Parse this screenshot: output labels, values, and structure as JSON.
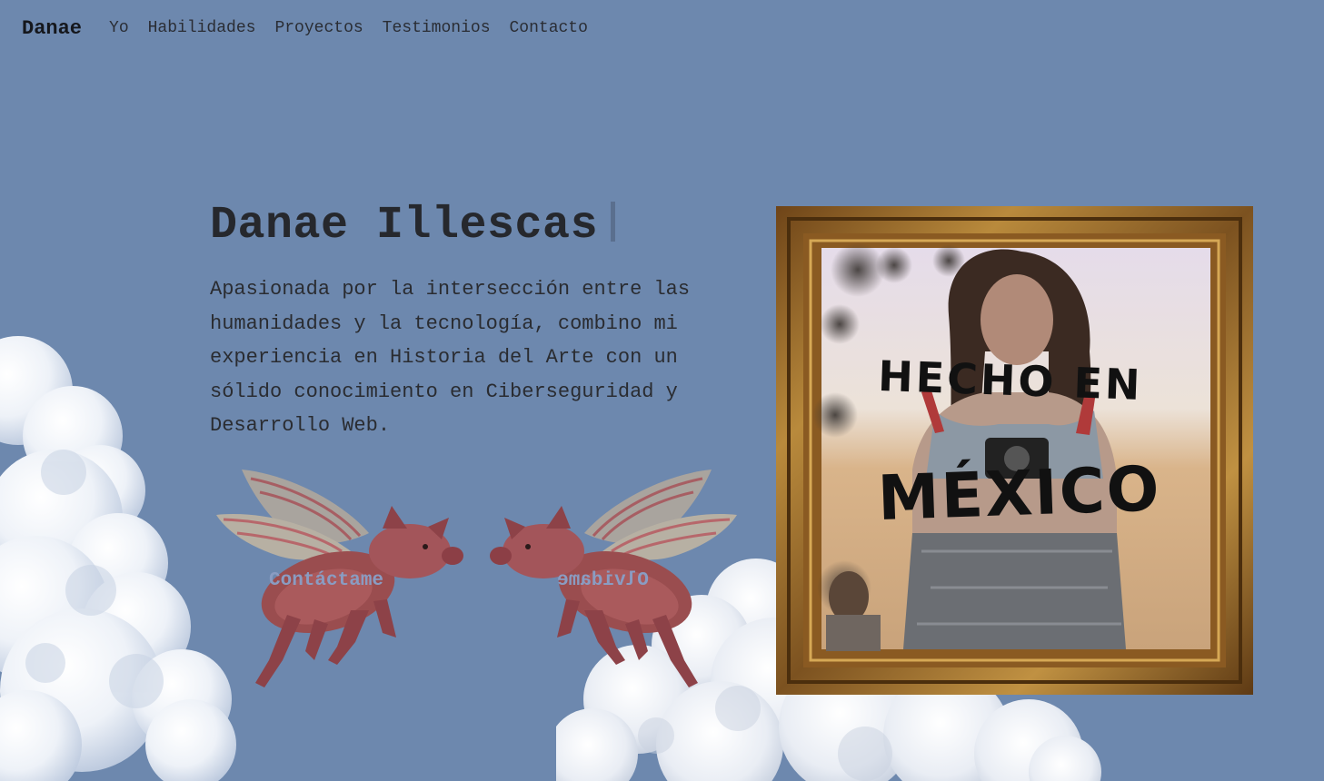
{
  "nav": {
    "brand": "Danae",
    "links": [
      "Yo",
      "Habilidades",
      "Proyectos",
      "Testimonios",
      "Contacto"
    ]
  },
  "hero": {
    "title": "Danae Illescas",
    "description": "Apasionada por la intersección entre las humanidades y la tecnología, combino mi experiencia en Historia del Arte con un sólido conocimiento en Ciberseguridad y Desarrollo Web."
  },
  "buttons": {
    "contact": "Contáctame",
    "forget": "Olvidame"
  },
  "portrait": {
    "text_line_1": "HECHO EN",
    "text_line_2": "MÉXICO",
    "icon": "framed-mirror-photo"
  },
  "colors": {
    "background": "#6d88ae",
    "text": "#2a2c31",
    "frame": "#9a6a2a"
  }
}
